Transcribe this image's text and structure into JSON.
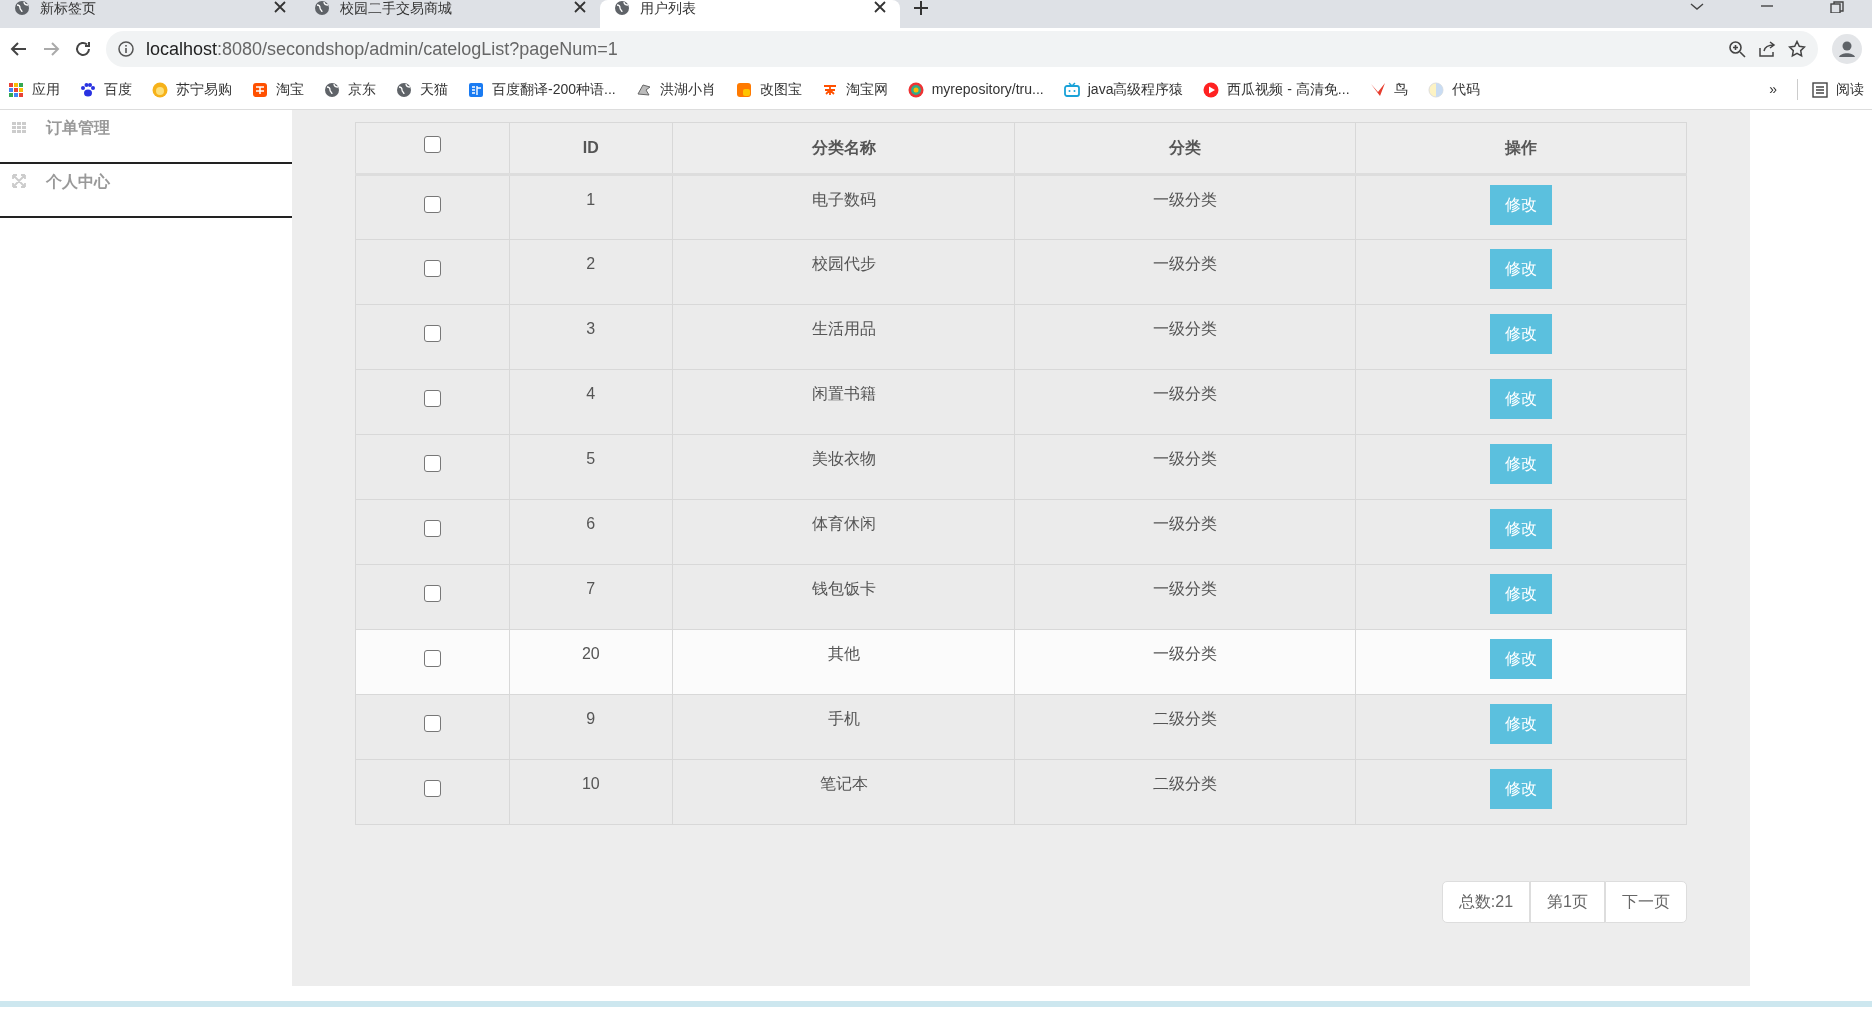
{
  "browser": {
    "tabs": [
      {
        "title": "新标签页",
        "selected": false
      },
      {
        "title": "校园二手交易商城",
        "selected": false
      },
      {
        "title": "用户列表",
        "selected": true
      }
    ],
    "address": {
      "host": "localhost",
      "rest": ":8080/secondshop/admin/catelogList?pageNum=1"
    },
    "bookmarks": [
      "应用",
      "百度",
      "苏宁易购",
      "淘宝",
      "京东",
      "天猫",
      "百度翻译-200种语...",
      "洪湖小肖",
      "改图宝",
      "淘宝网",
      "myrepository/tru...",
      "java高级程序猿",
      "西瓜视频 - 高清免...",
      "鸟",
      "代码"
    ],
    "more": "»",
    "reading_list": "阅读"
  },
  "sidebar": {
    "items": [
      "订单管理",
      "个人中心"
    ]
  },
  "table": {
    "columns": [
      "ID",
      "分类名称",
      "分类",
      "操作"
    ],
    "header_checked": false,
    "rows": [
      {
        "checked": false,
        "highlighted": false,
        "id": "1",
        "name": "电子数码",
        "level": "一级分类",
        "action": "修改"
      },
      {
        "checked": false,
        "highlighted": false,
        "id": "2",
        "name": "校园代步",
        "level": "一级分类",
        "action": "修改"
      },
      {
        "checked": false,
        "highlighted": false,
        "id": "3",
        "name": "生活用品",
        "level": "一级分类",
        "action": "修改"
      },
      {
        "checked": false,
        "highlighted": false,
        "id": "4",
        "name": "闲置书籍",
        "level": "一级分类",
        "action": "修改"
      },
      {
        "checked": false,
        "highlighted": false,
        "id": "5",
        "name": "美妆衣物",
        "level": "一级分类",
        "action": "修改"
      },
      {
        "checked": false,
        "highlighted": false,
        "id": "6",
        "name": "体育休闲",
        "level": "一级分类",
        "action": "修改"
      },
      {
        "checked": false,
        "highlighted": false,
        "id": "7",
        "name": "钱包饭卡",
        "level": "一级分类",
        "action": "修改"
      },
      {
        "checked": false,
        "highlighted": true,
        "id": "20",
        "name": "其他",
        "level": "一级分类",
        "action": "修改"
      },
      {
        "checked": false,
        "highlighted": false,
        "id": "9",
        "name": "手机",
        "level": "二级分类",
        "action": "修改"
      },
      {
        "checked": false,
        "highlighted": false,
        "id": "10",
        "name": "笔记本",
        "level": "二级分类",
        "action": "修改"
      }
    ]
  },
  "pagination": [
    "总数:21",
    "第1页",
    "下一页"
  ]
}
